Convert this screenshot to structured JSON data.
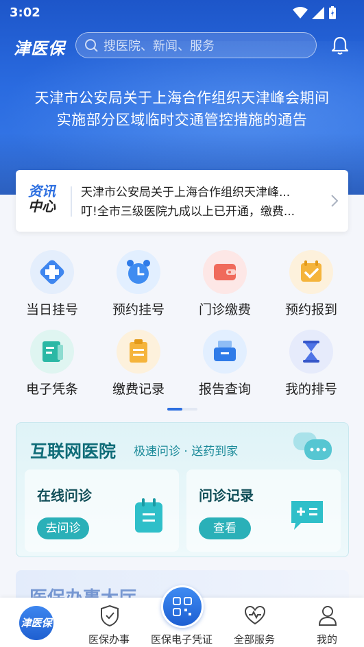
{
  "status": {
    "time": "3:02"
  },
  "header": {
    "logo": "津医保",
    "search_placeholder": "搜医院、新闻、服务"
  },
  "banner": {
    "line1": "天津市公安局关于上海合作组织天津峰会期间",
    "line2": "实施部分区域临时交通管控措施的通告"
  },
  "news": {
    "badge_line1": "资讯",
    "badge_line2": "中心",
    "items": [
      "天津市公安局关于上海合作组织天津峰...",
      "叮!全市三级医院九成以上已开通，缴费..."
    ]
  },
  "services": [
    {
      "label": "当日挂号",
      "icon": "same-day-registration-icon",
      "color": "#e4eefc"
    },
    {
      "label": "预约挂号",
      "icon": "alarm-clock-icon",
      "color": "#e2efff"
    },
    {
      "label": "门诊缴费",
      "icon": "wallet-icon",
      "color": "#fde7e6"
    },
    {
      "label": "预约报到",
      "icon": "calendar-check-icon",
      "color": "#fdf1dc"
    },
    {
      "label": "电子凭条",
      "icon": "receipt-icon",
      "color": "#dff5f1"
    },
    {
      "label": "缴费记录",
      "icon": "clipboard-icon",
      "color": "#fdf1dc"
    },
    {
      "label": "报告查询",
      "icon": "report-tray-icon",
      "color": "#e2efff"
    },
    {
      "label": "我的排号",
      "icon": "hourglass-icon",
      "color": "#e6ebfb"
    }
  ],
  "internet_hospital": {
    "title": "互联网医院",
    "subtitle": "极速问诊 · 送药到家",
    "panels": [
      {
        "title": "在线问诊",
        "button": "去问诊"
      },
      {
        "title": "问诊记录",
        "button": "查看"
      }
    ]
  },
  "lower_card": {
    "title": "医保办事大厅"
  },
  "tabbar": {
    "logo": "津医保",
    "items": [
      "医保办事",
      "医保电子凭证",
      "全部服务",
      "我的"
    ]
  }
}
